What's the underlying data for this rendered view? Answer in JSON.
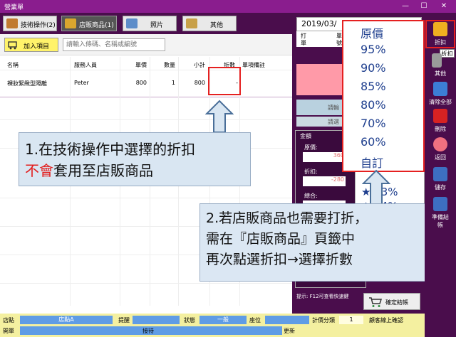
{
  "window": {
    "title": "營業單",
    "minimize": "—",
    "maximize": "☐",
    "close": "✕"
  },
  "tabs": [
    {
      "label": "技術操作(2)"
    },
    {
      "label": "店販商品(1)"
    },
    {
      "label": "照片"
    },
    {
      "label": "其他"
    }
  ],
  "toolbar": {
    "add_label": "加入項目",
    "search_placeholder": "請輸入條碼、名稱或編號"
  },
  "table": {
    "headers": [
      "名稱",
      "服務人員",
      "單價",
      "數量",
      "小計",
      "折數",
      "單項備註"
    ],
    "rows": [
      {
        "name": "裸妝緊緻型隔離",
        "staff": "Peter",
        "price": "800",
        "qty": "1",
        "subtotal": "800",
        "discount": "-"
      }
    ]
  },
  "callout1": {
    "line1": "1.在技術操作中選擇的折扣",
    "line2_red": "不會",
    "line2_rest": "套用至店販商品"
  },
  "callout2": {
    "line1": "2.若店販商品也需要打折，",
    "line2": "需在『店販商品』頁籤中",
    "line3": "再次點選折扣→選擇折數"
  },
  "right_panel": {
    "date": "2019/03/",
    "info_left_1": "打",
    "info_left_2": "單",
    "info_mid_1": "單",
    "info_mid_2": "號",
    "btn_a": "請輸",
    "btn_b": "請選",
    "amount_title": "金額",
    "amount_rows": [
      {
        "label": "原價:",
        "value": "360"
      },
      {
        "label": "折扣:",
        "value": "-280"
      },
      {
        "label": "總合:",
        "value": ""
      }
    ],
    "tip": "提示: F12可查看快速鍵",
    "checkout": "確定結帳"
  },
  "discount_menu": [
    "原價",
    "95%",
    "90%",
    "85%",
    "80%",
    "70%",
    "60%",
    "自訂"
  ],
  "behind_menu": [
    "★ 83%",
    "★ 84%"
  ],
  "sidebar": [
    {
      "label": "折扣",
      "icon": "discount-icon"
    },
    {
      "label": "其他",
      "icon": "other-icon"
    },
    {
      "label": "清除全部",
      "icon": "clear-all-icon"
    },
    {
      "label": "刪除",
      "icon": "delete-icon"
    },
    {
      "label": "返回",
      "icon": "back-icon"
    },
    {
      "label": "儲存",
      "icon": "save-icon"
    },
    {
      "label": "準備結帳",
      "icon": "prepare-checkout-icon"
    }
  ],
  "sidebar_tooltip": "折扣",
  "statusbar": {
    "store_label": "店點",
    "store_value": "店點A",
    "handle_label": "提醒",
    "status_label": "狀態",
    "status_value": "一般",
    "seat_label": "座位",
    "timer_label": "計價分類",
    "timer_value": "1",
    "confirm_label": "顧客線上確認",
    "open_label": "開單",
    "receive_label": "接待",
    "update_label": "更新"
  },
  "colors": {
    "frame": "#6d1f6f",
    "accent_red": "#e52020",
    "menu_text": "#1f3f8e",
    "status_blue": "#5f9ce5"
  }
}
